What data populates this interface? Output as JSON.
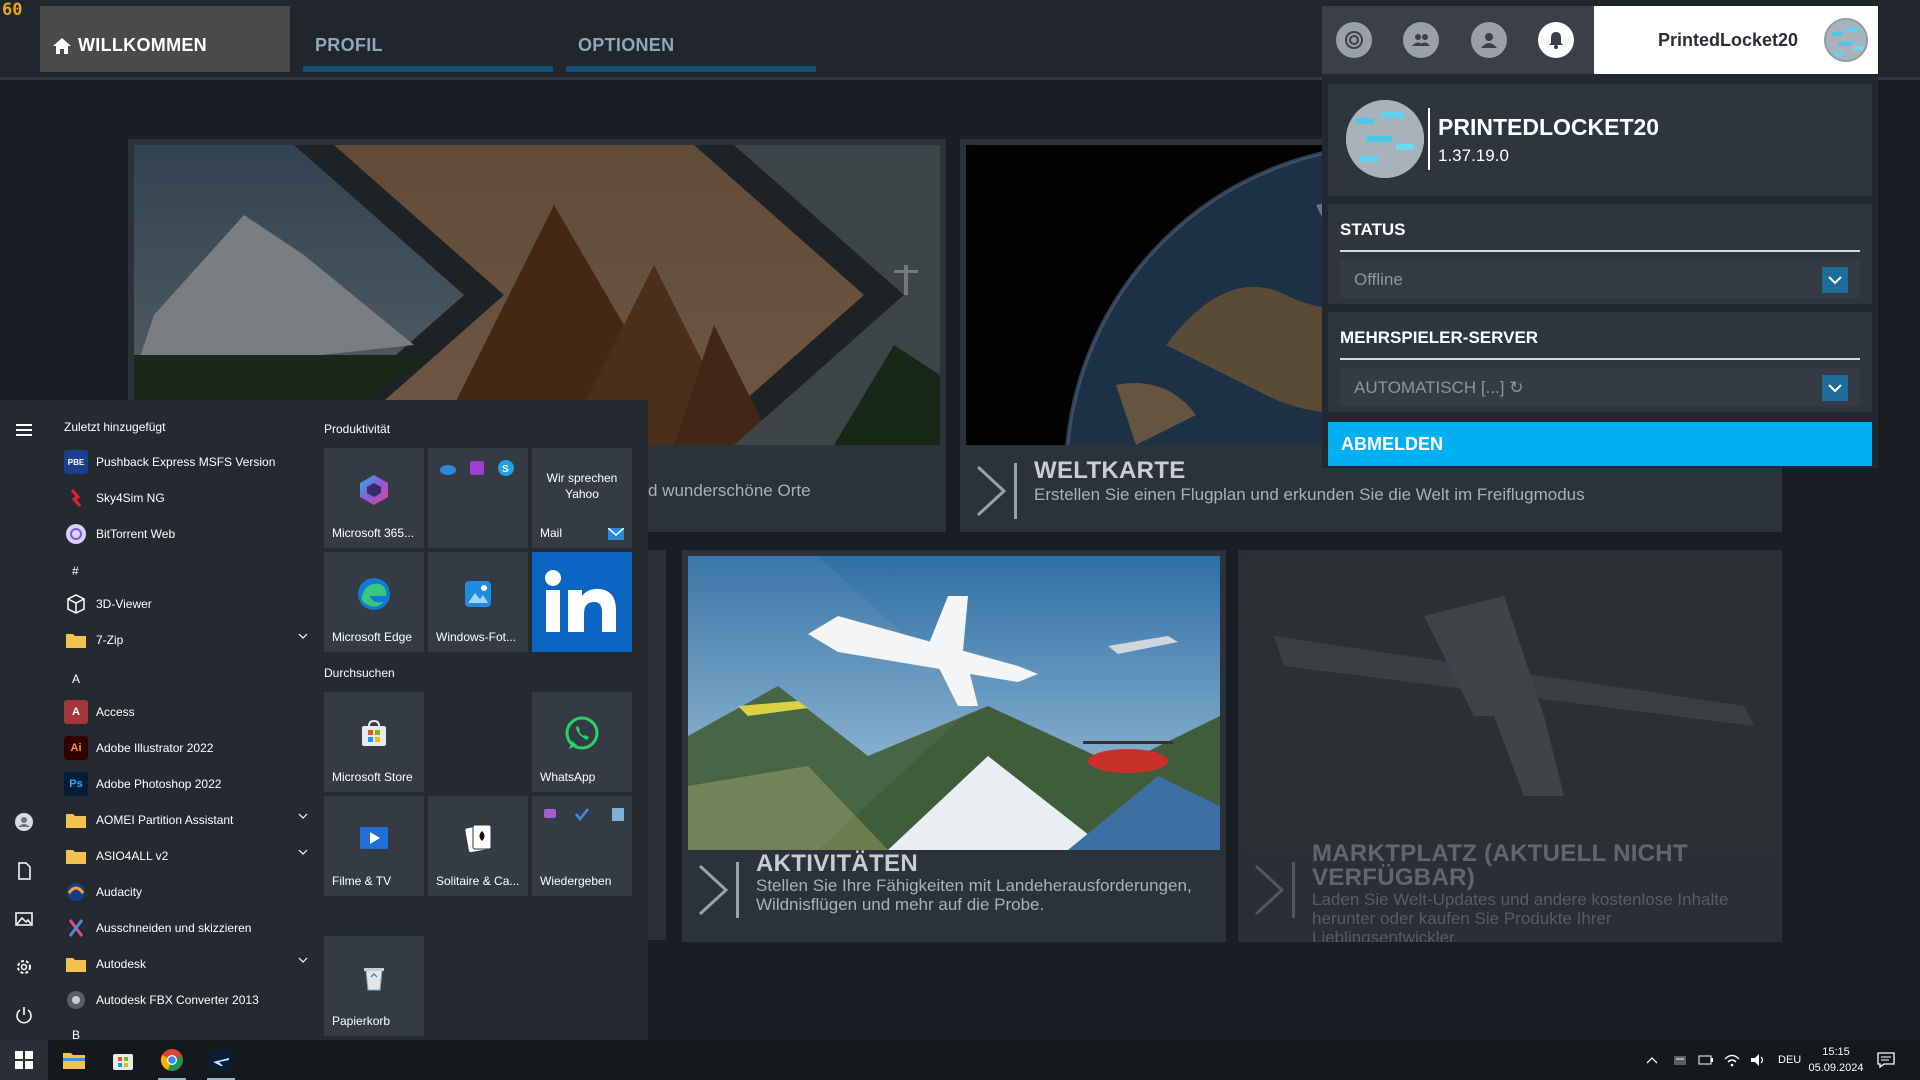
{
  "fps": "60",
  "nav": {
    "tabs": [
      {
        "label": "WILLKOMMEN",
        "active": true
      },
      {
        "label": "PROFIL",
        "active": false
      },
      {
        "label": "OPTIONEN",
        "active": false
      }
    ]
  },
  "topicons": [
    "achievements-icon",
    "friends-icon",
    "profile-icon",
    "notifications-icon"
  ],
  "user": {
    "name": "PrintedLocket20"
  },
  "profile_panel": {
    "name": "PRINTEDLOCKET20",
    "version": "1.37.19.0",
    "status": {
      "title": "STATUS",
      "value": "Offline"
    },
    "server": {
      "title": "MEHRSPIELER-SERVER",
      "value": "AUTOMATISCH [...] ↻"
    },
    "logout": "ABMELDEN"
  },
  "tiles": {
    "discovery": {
      "desc": "d wunderschöne Orte"
    },
    "worldmap": {
      "title": "WELTKARTE",
      "desc": "Erstellen Sie einen Flugplan und erkunden Sie die Welt im Freiflugmodus"
    },
    "activities": {
      "title": "AKTIVITÄTEN",
      "desc": "Stellen Sie Ihre Fähigkeiten mit Landeherausforderungen, Wildnisflügen und mehr auf die Probe."
    },
    "marketplace": {
      "title": "MARKTPLATZ (AKTUELL NICHT VERFÜGBAR)",
      "desc": "Laden Sie Welt-Updates und andere kostenlose Inhalte herunter oder kaufen Sie Produkte Ihrer Lieblingsentwickler."
    }
  },
  "startmenu": {
    "recent_header": "Zuletzt hinzugefügt",
    "recent": [
      {
        "label": "Pushback Express MSFS Version",
        "icon": "pushback-icon"
      },
      {
        "label": "Sky4Sim NG",
        "icon": "sky4sim-icon"
      },
      {
        "label": "BitTorrent Web",
        "icon": "bittorrent-icon"
      }
    ],
    "letters": [
      "#",
      "A",
      "B"
    ],
    "apps": [
      {
        "label": "3D-Viewer",
        "icon": "cube-icon"
      },
      {
        "label": "7-Zip",
        "icon": "folder-icon"
      },
      {
        "label": "Access",
        "icon": "access-icon"
      },
      {
        "label": "Adobe Illustrator 2022",
        "icon": "illustrator-icon"
      },
      {
        "label": "Adobe Photoshop 2022",
        "icon": "photoshop-icon"
      },
      {
        "label": "AOMEI Partition Assistant",
        "icon": "folder-icon"
      },
      {
        "label": "ASIO4ALL v2",
        "icon": "folder-icon"
      },
      {
        "label": "Audacity",
        "icon": "audacity-icon"
      },
      {
        "label": "Ausschneiden und skizzieren",
        "icon": "snip-icon"
      },
      {
        "label": "Autodesk",
        "icon": "folder-icon"
      },
      {
        "label": "Autodesk FBX Converter 2013",
        "icon": "fbx-icon"
      }
    ],
    "groups": {
      "productivity": "Produktivität",
      "browse": "Durchsuchen"
    },
    "tiles": {
      "m365": "Microsoft 365...",
      "yahoo": "Wir sprechen Yahoo",
      "mail": "Mail",
      "edge": "Microsoft Edge",
      "photos": "Windows-Fot...",
      "store": "Microsoft Store",
      "whatsapp": "WhatsApp",
      "movies": "Filme & TV",
      "solitaire": "Solitaire & Ca...",
      "play": "Wiedergeben",
      "recycle": "Papierkorb"
    }
  },
  "taskbar": {
    "language": "DEU",
    "time": "15:15",
    "date": "05.09.2024"
  },
  "colors": {
    "accent": "#00b0f0",
    "tab_bar": "#124f75",
    "linkedin": "#0a66c2",
    "fps": "#e6a81c"
  }
}
